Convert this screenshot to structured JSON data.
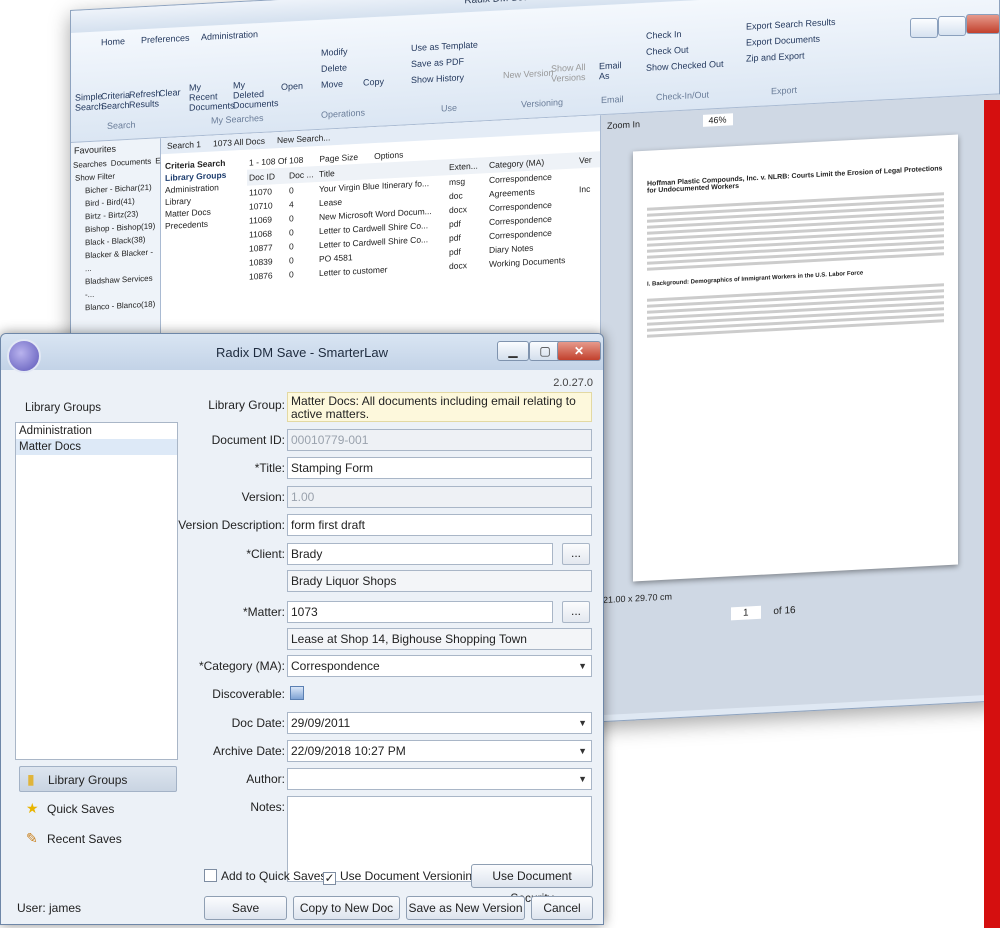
{
  "background_app": {
    "title": "Radix DM Search - SmarterLaw",
    "ribbon_tabs": [
      "Home",
      "Preferences",
      "Administration"
    ],
    "ribbon_items": [
      "Simple Search",
      "Criteria Search",
      "Refresh Results",
      "Clear",
      "My Recent Documents",
      "My Deleted Documents",
      "Open",
      "Modify",
      "Delete",
      "Move",
      "Copy",
      "Use as Template",
      "Save as PDF",
      "Show History",
      "New Version",
      "Show All Versions",
      "Email As",
      "Check In",
      "Check Out",
      "Show Checked Out",
      "Export Search Results",
      "Export Documents",
      "Zip and Export"
    ],
    "ribbon_groups": [
      "Search",
      "My Searches",
      "Operations",
      "Use",
      "Versioning",
      "Email",
      "Check-In/Out",
      "Export"
    ],
    "left_tabs": [
      "Searches",
      "Documents",
      "Explorer"
    ],
    "favourites": "Favourites",
    "show_filter": "Show Filter",
    "tree": [
      "Bicher - Bichar(21)",
      "Bird - Bird(41)",
      "Birtz - Birtz(23)",
      "Bishop - Bishop(19)",
      "Black - Black(38)",
      "Blacker & Blacker - ...",
      "Bladshaw Services -...",
      "Blanco - Blanco(18)"
    ],
    "doc_tabs": [
      "Search 1",
      "1073 All Docs",
      "New Search..."
    ],
    "criteria_title": "Criteria Search",
    "library_groups_label": "Library Groups",
    "criteria_items": [
      "Administration",
      "Library",
      "Matter Docs",
      "Precedents"
    ],
    "pager": "1 - 108 Of 108",
    "page_size": "Page Size",
    "options": "Options",
    "columns": [
      "Doc ID",
      "Doc ...",
      "Title",
      "Exten...",
      "Category (MA)",
      "Ver"
    ],
    "rows": [
      [
        "11070",
        "0",
        "Your Virgin Blue Itinerary fo...",
        "msg",
        "Correspondence",
        ""
      ],
      [
        "10710",
        "4",
        "Lease",
        "doc",
        "Agreements",
        "Inc"
      ],
      [
        "11069",
        "0",
        "New Microsoft Word Docum...",
        "docx",
        "Correspondence",
        ""
      ],
      [
        "11068",
        "0",
        "Letter to Cardwell Shire Co...",
        "pdf",
        "Correspondence",
        ""
      ],
      [
        "10877",
        "0",
        "Letter to Cardwell Shire Co...",
        "pdf",
        "Correspondence",
        ""
      ],
      [
        "10839",
        "0",
        "PO 4581",
        "pdf",
        "Diary Notes",
        ""
      ],
      [
        "10876",
        "0",
        "Letter to customer",
        "docx",
        "Working Documents",
        ""
      ]
    ],
    "zoom_label": "Zoom In",
    "zoom_value": "46%",
    "page_size_cm": "21.00 x 29.70 cm",
    "page_num": "1",
    "page_of": "of 16",
    "preview_title": "Hoffman Plastic Compounds, Inc. v. NLRB: Courts Limit the Erosion of Legal Protections for Undocumented Workers",
    "preview_heading": "I. Background: Demographics of Immigrant Workers in the U.S. Labor Force"
  },
  "dialog": {
    "title": "Radix DM Save - SmarterLaw",
    "version": "2.0.27.0",
    "library_groups_header": "Library Groups",
    "library_groups": [
      "Administration",
      "Matter Docs"
    ],
    "nav": [
      {
        "label": "Library Groups",
        "icon": "folder-icon"
      },
      {
        "label": "Quick Saves",
        "icon": "star-icon"
      },
      {
        "label": "Recent Saves",
        "icon": "document-edit-icon"
      }
    ],
    "user": "User: james",
    "fields": {
      "library_group_label": "Library Group:",
      "library_group": "Matter Docs: All documents including email relating to active matters.",
      "document_id_label": "Document ID:",
      "document_id": "00010779-001",
      "title_label": "*Title:",
      "title": "Stamping Form",
      "version_label": "Version:",
      "version": "1.00",
      "version_description_label": "Version Description:",
      "version_description": "form first draft",
      "client_label": "*Client:",
      "client": "Brady",
      "client_name": "Brady Liquor Shops",
      "matter_label": "*Matter:",
      "matter": "1073",
      "matter_description": "Lease at Shop 14, Bighouse Shopping Town",
      "category_label": "*Category (MA):",
      "category": "Correspondence",
      "discoverable_label": "Discoverable:",
      "doc_date_label": "Doc Date:",
      "doc_date": "29/09/2011",
      "archive_date_label": "Archive Date:",
      "archive_date": "22/09/2018 10:27 PM",
      "author_label": "Author:",
      "author": "",
      "notes_label": "Notes:",
      "notes": ""
    },
    "ellipsis": "...",
    "add_quick_saves": "Add to Quick Saves",
    "use_versioning": "Use Document Versioning",
    "use_security": "Use Document Security",
    "buttons": {
      "save": "Save",
      "copy": "Copy to New Doc",
      "save_version": "Save as New Version",
      "cancel": "Cancel"
    }
  }
}
